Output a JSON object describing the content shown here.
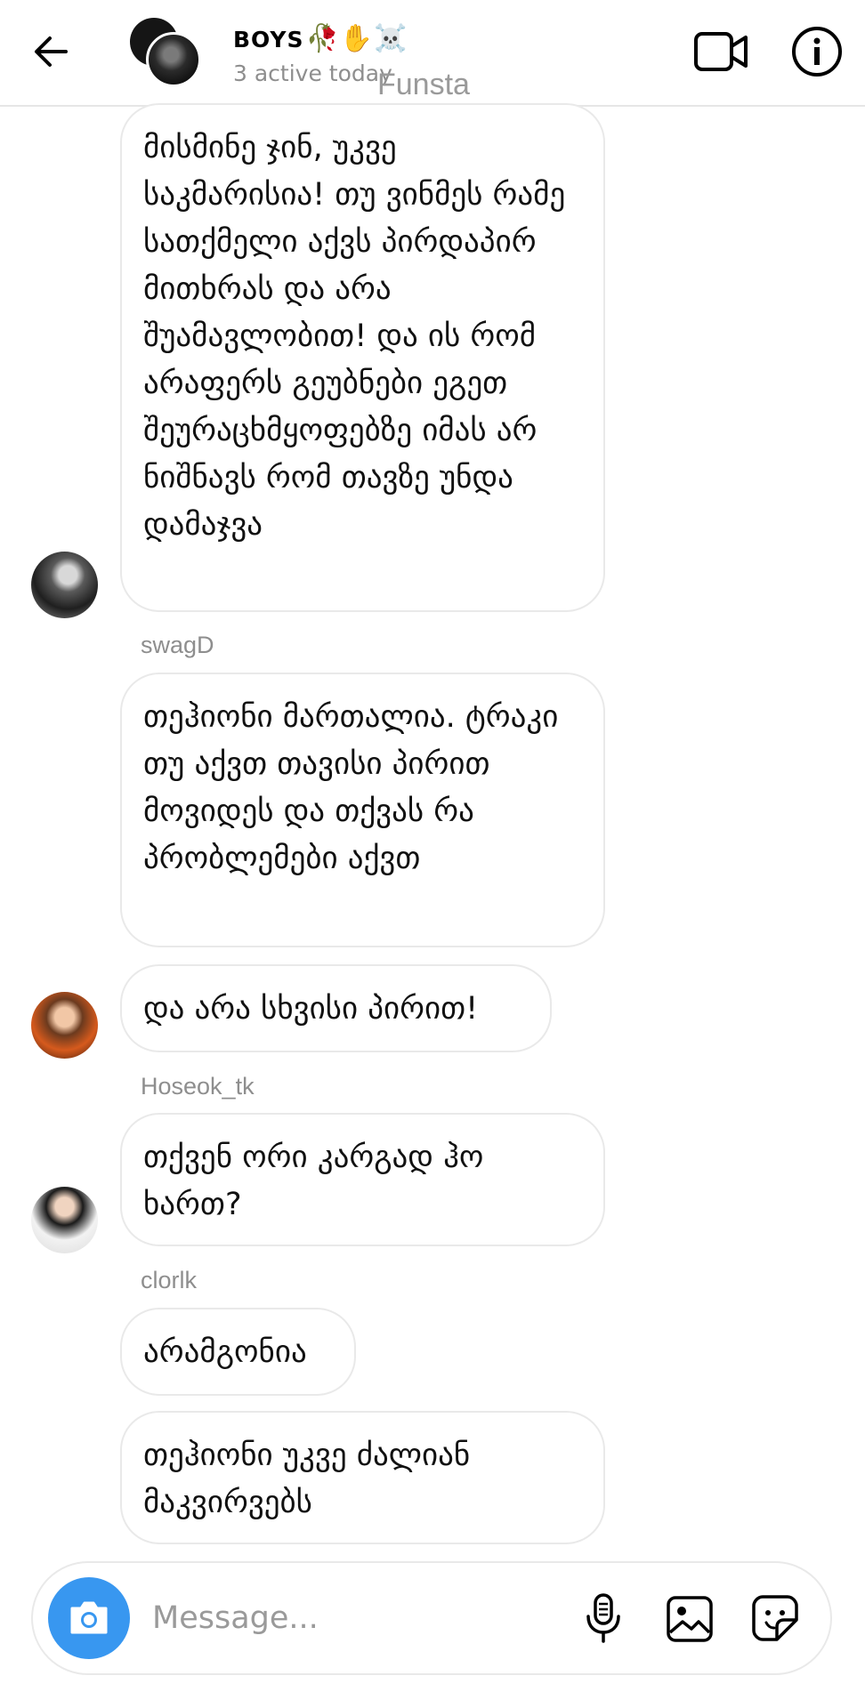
{
  "header": {
    "title": "BOYS",
    "title_emoji": "🥀✋☠️",
    "subtitle": "3 active today",
    "watermark": "Funsta"
  },
  "messages": {
    "m1": "მისმინე ჯინ, უკვე საკმარისია! თუ ვინმეს რამე სათქმელი აქვს პირდაპირ მითხრას და არა შუამავლობით! და ის რომ არაფერს გეუბნები ეგეთ შეურაცხმყოფებზე იმას არ ნიშნავს რომ თავზე უნდა დამაჯვა",
    "sender2": "swagD",
    "m2": "თეჰიონი მართალია. ტრაკი თუ აქვთ თავისი პირით მოვიდეს და თქვას რა პრობლემები აქვთ",
    "m3": "და არა სხვისი პირით!",
    "sender4": "Hoseok_tk",
    "m4": "თქვენ ორი კარგად ჰო ხართ?",
    "sender5": "clorlk",
    "m5": "არამგონია",
    "m6": "თეჰიონი უკვე ძალიან მაკვირვებს"
  },
  "composer": {
    "placeholder": "Message..."
  },
  "colors": {
    "accent": "#3897f0",
    "bubble_border": "#e9e9e9",
    "secondary_text": "#8e8e8e"
  },
  "icons": {
    "back": "arrow-left-icon",
    "video": "video-camera-icon",
    "info": "info-icon",
    "camera": "camera-icon",
    "mic": "microphone-icon",
    "gallery": "image-icon",
    "sticker": "sticker-icon"
  }
}
